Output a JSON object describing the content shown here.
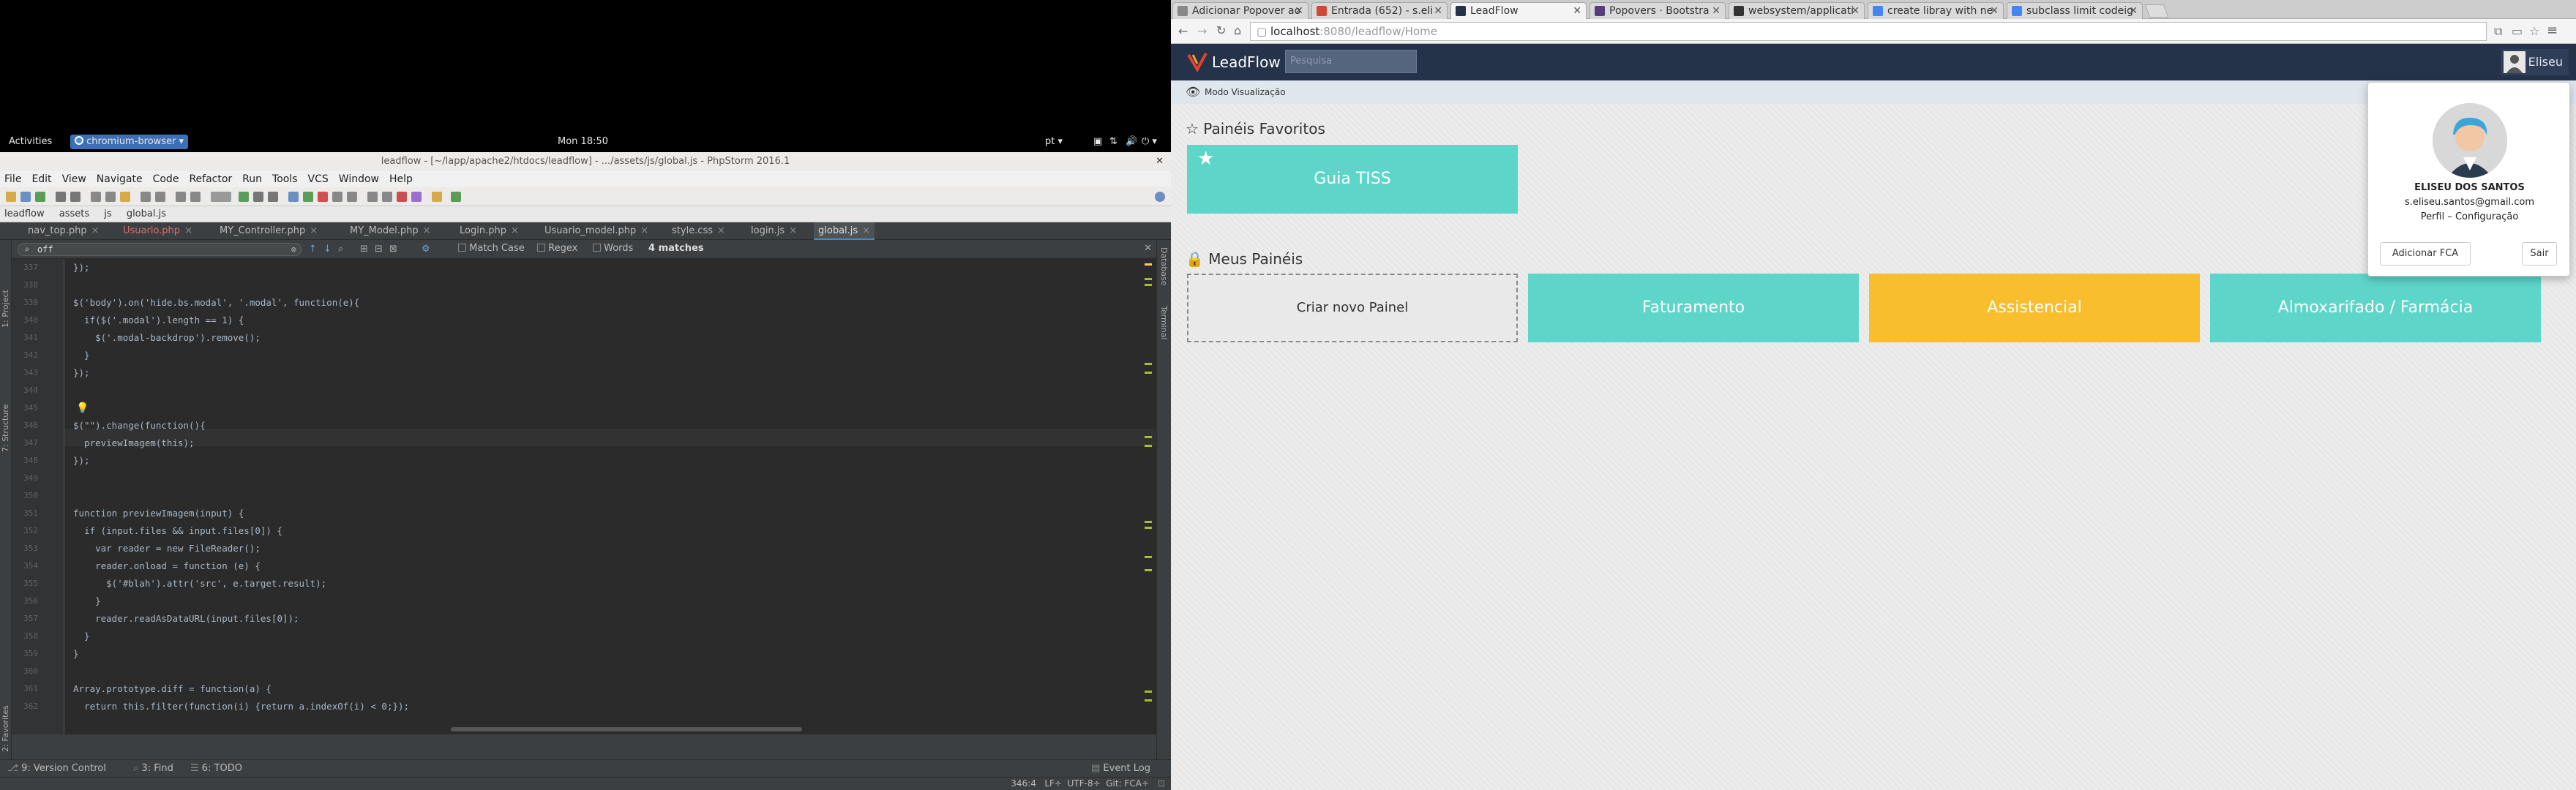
{
  "gnome": {
    "activities": "Activities",
    "app_name": "chromium-browser",
    "clock": "Mon 18:50",
    "lang": "pt"
  },
  "ide": {
    "title": "leadflow - [~/lapp/apache2/htdocs/leadflow] - .../assets/js/global.js - PhpStorm 2016.1",
    "menu": [
      "File",
      "Edit",
      "View",
      "Navigate",
      "Code",
      "Refactor",
      "Run",
      "Tools",
      "VCS",
      "Window",
      "Help"
    ],
    "breadcrumb": [
      "leadflow",
      "assets",
      "js",
      "global.js"
    ],
    "tabs": [
      "nav_top.php",
      "Usuario.php",
      "MY_Controller.php",
      "MY_Model.php",
      "Login.php",
      "Usuario_model.php",
      "style.css",
      "login.js",
      "global.js"
    ],
    "find": {
      "query": "off",
      "match_case": "Match Case",
      "regex": "Regex",
      "words": "Words",
      "matches": "4 matches"
    },
    "left_tools": [
      "1: Project",
      "7: Structure",
      "2: Favorites"
    ],
    "right_tools": [
      "Database",
      "Terminal"
    ],
    "code": [
      {
        "n": "337",
        "t": "});"
      },
      {
        "n": "338",
        "t": ""
      },
      {
        "n": "339",
        "t": "$('body').on('hide.bs.modal', '.modal', function(e){"
      },
      {
        "n": "340",
        "t": "  if($('.modal').length == 1) {"
      },
      {
        "n": "341",
        "t": "    $('.modal-backdrop').remove();"
      },
      {
        "n": "342",
        "t": "  }"
      },
      {
        "n": "343",
        "t": "});"
      },
      {
        "n": "344",
        "t": ""
      },
      {
        "n": "345",
        "t": ""
      },
      {
        "n": "346",
        "t": "$(\"\").change(function(){"
      },
      {
        "n": "347",
        "t": "  previewImagem(this);"
      },
      {
        "n": "348",
        "t": "});"
      },
      {
        "n": "349",
        "t": ""
      },
      {
        "n": "350",
        "t": ""
      },
      {
        "n": "351",
        "t": "function previewImagem(input) {"
      },
      {
        "n": "352",
        "t": "  if (input.files && input.files[0]) {"
      },
      {
        "n": "353",
        "t": "    var reader = new FileReader();"
      },
      {
        "n": "354",
        "t": "    reader.onload = function (e) {"
      },
      {
        "n": "355",
        "t": "      $('#blah').attr('src', e.target.result);"
      },
      {
        "n": "356",
        "t": "    }"
      },
      {
        "n": "357",
        "t": "    reader.readAsDataURL(input.files[0]);"
      },
      {
        "n": "358",
        "t": "  }"
      },
      {
        "n": "359",
        "t": "}"
      },
      {
        "n": "360",
        "t": ""
      },
      {
        "n": "361",
        "t": "Array.prototype.diff = function(a) {"
      },
      {
        "n": "362",
        "t": "  return this.filter(function(i) {return a.indexOf(i) < 0;});"
      }
    ],
    "toolwindows": {
      "vcs": "9: Version Control",
      "find": "3: Find",
      "todo": "6: TODO",
      "event_log": "Event Log"
    },
    "status": "346:4   LF÷  UTF-8÷  Git: FCA÷"
  },
  "browser": {
    "tabs": [
      {
        "label": "Adicionar Popover ao",
        "color": "#888888"
      },
      {
        "label": "Entrada (652) - s.eli",
        "color": "#d14836"
      },
      {
        "label": "LeadFlow",
        "color": "#24324a"
      },
      {
        "label": "Popovers · Bootstra",
        "color": "#563d7c"
      },
      {
        "label": "websystem/applicati",
        "color": "#333333"
      },
      {
        "label": "create libray with ne",
        "color": "#4285f4"
      },
      {
        "label": "subclass limit codeig",
        "color": "#4285f4"
      }
    ],
    "url_host": "localhost",
    "url_path": ":8080/leadflow/Home"
  },
  "leadflow": {
    "brand": "LeadFlow",
    "search_placeholder": "Pesquisa",
    "user": "Eliseu",
    "mode": "Modo Visualização",
    "favorites_title": "Painéis Favoritos",
    "favorite_tile": "Guia TISS",
    "my_panels_title": "Meus Painéis",
    "new_panel": "Criar novo Painel",
    "panels": [
      "Faturamento",
      "Assistencial",
      "Almoxarifado / Farmácia"
    ],
    "popover": {
      "name": "ELISEU DOS SANTOS",
      "email": "s.eliseu.santos@gmail.com",
      "links": "Perfil – Configuração",
      "add_fca": "Adicionar FCA",
      "logout": "Sair"
    },
    "colors": {
      "teal": "#5dd5c9",
      "yellow": "#f8be2e",
      "navbar": "#24324a"
    }
  }
}
